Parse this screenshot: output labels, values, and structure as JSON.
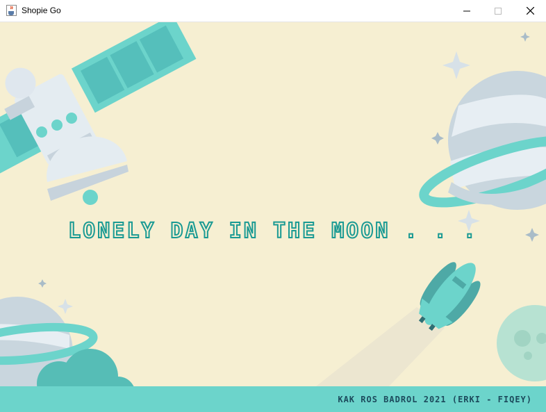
{
  "window": {
    "title": "Shopie Go",
    "icon": "java-cup-icon",
    "controls": [
      "minimize",
      "maximize",
      "close"
    ]
  },
  "scene": {
    "headline": "LONELY DAY IN THE MOON . . .",
    "credit": "KAK ROS BADROL 2021 (ERKI - FIQEY)",
    "colors": {
      "background": "#f6efd2",
      "accent": "#6cd4cb",
      "headline": "#1a9a93",
      "credit": "#1c4a5c"
    }
  }
}
